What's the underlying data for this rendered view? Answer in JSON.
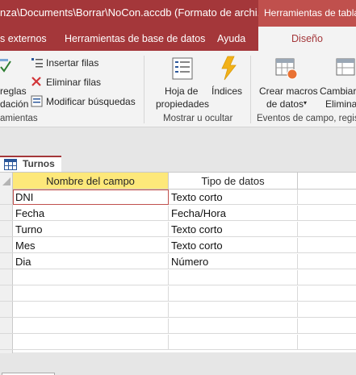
{
  "title_bar": {
    "title": "nza\\Documents\\Borrar\\NoCon.accdb (Formato de archi...",
    "contextual_tab_group": "Herramientas de tabla"
  },
  "tabs": [
    {
      "label": "s externos"
    },
    {
      "label": "Herramientas de base de datos"
    },
    {
      "label": "Ayuda"
    },
    {
      "label": "Diseño"
    }
  ],
  "ribbon": {
    "rules_partial": [
      "reglas",
      "dación"
    ],
    "insert_rows": "Insertar filas",
    "delete_rows": "Eliminar filas",
    "modify_lookups": "Modificar búsquedas",
    "group_tools_partial": "amientas",
    "property_sheet": [
      "Hoja de",
      "propiedades"
    ],
    "indexes": "Índices",
    "group_show_hide": "Mostrar u ocultar",
    "create_macros": [
      "Crear macros",
      "de datos"
    ],
    "rename_delete_partial": [
      "Cambiar",
      "Elimina"
    ],
    "group_field_events": "Eventos de campo, regis"
  },
  "document": {
    "tab_label": "Turnos"
  },
  "table": {
    "columns": [
      "Nombre del campo",
      "Tipo de datos"
    ],
    "rows": [
      {
        "field": "DNI",
        "type": "Texto corto"
      },
      {
        "field": "Fecha",
        "type": "Fecha/Hora"
      },
      {
        "field": "Turno",
        "type": "Texto corto"
      },
      {
        "field": "Mes",
        "type": "Texto corto"
      },
      {
        "field": "Dia",
        "type": "Número"
      },
      {
        "field": "",
        "type": ""
      },
      {
        "field": "",
        "type": ""
      },
      {
        "field": "",
        "type": ""
      },
      {
        "field": "",
        "type": ""
      },
      {
        "field": "",
        "type": ""
      }
    ]
  },
  "colors": {
    "accent": "#a4373a",
    "contextual": "#c0504d",
    "header_selected": "#fde87a"
  }
}
